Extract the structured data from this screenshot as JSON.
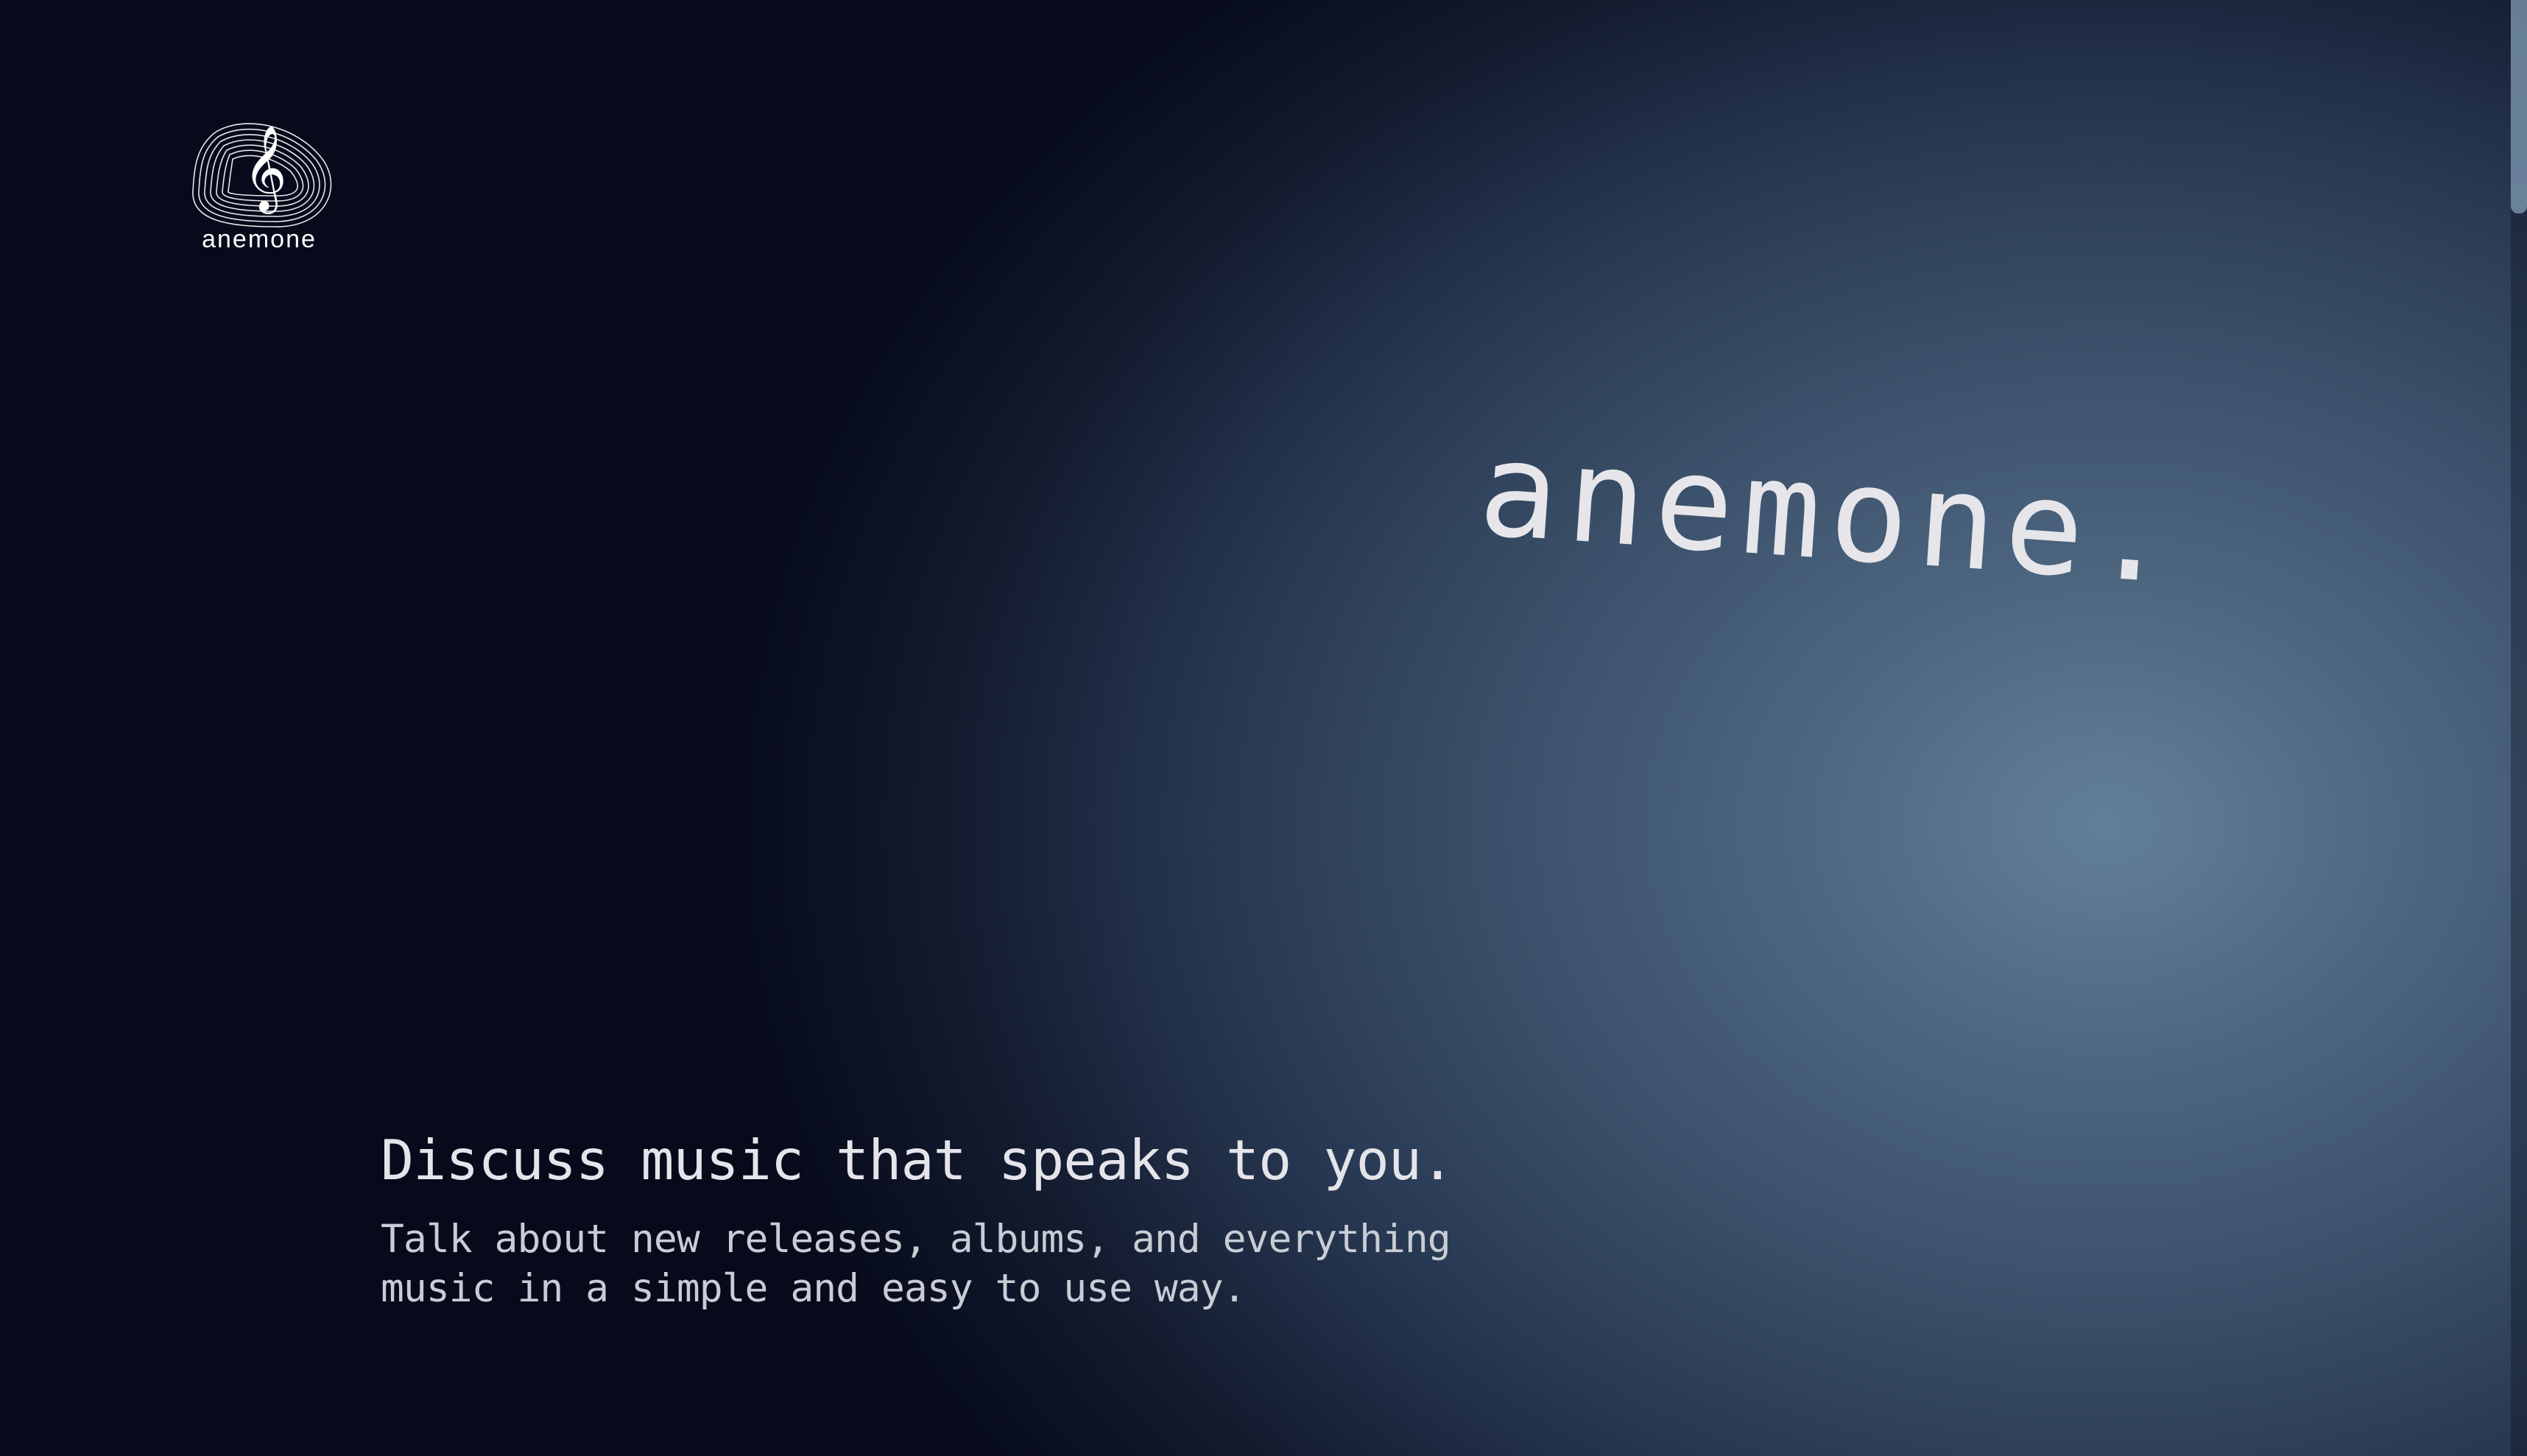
{
  "logo": {
    "icon": "treble-clef-icon",
    "clef_glyph": "𝄞",
    "text": "anemone"
  },
  "hero": {
    "brand": "anemone."
  },
  "tagline": {
    "headline": "Discuss music that speaks to you.",
    "subline_line1": "Talk about new releases, albums, and everything",
    "subline_line2": "music in a simple and easy to use way."
  },
  "colors": {
    "background_glow": "#627f99",
    "background_dark": "#03050f",
    "text": "#e4e4ea"
  }
}
